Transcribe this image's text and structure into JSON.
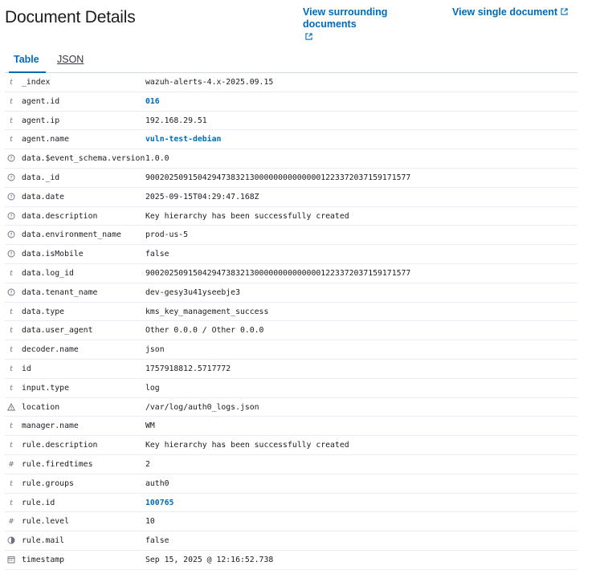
{
  "header": {
    "title": "Document Details",
    "view_surrounding": "View surrounding documents",
    "view_single": "View single document"
  },
  "tabs": [
    {
      "label": "Table",
      "active": true
    },
    {
      "label": "JSON",
      "active": false
    }
  ],
  "colors": {
    "accent": "#006bb8",
    "text": "#1a1c21",
    "muted": "#69707d",
    "divider": "#e9edf3"
  },
  "rows": [
    {
      "type": "t",
      "field": "_index",
      "value": "wazuh-alerts-4.x-2025.09.15",
      "link": false
    },
    {
      "type": "t",
      "field": "agent.id",
      "value": "016",
      "link": true
    },
    {
      "type": "t",
      "field": "agent.ip",
      "value": "192.168.29.51",
      "link": false
    },
    {
      "type": "t",
      "field": "agent.name",
      "value": "vuln-test-debian",
      "link": true
    },
    {
      "type": "?",
      "field": "data.$event_schema.version",
      "value": "1.0.0",
      "link": false
    },
    {
      "type": "?",
      "field": "data._id",
      "value": "90020250915042947383213000000000000001223372037159171577",
      "link": false
    },
    {
      "type": "?",
      "field": "data.date",
      "value": "2025-09-15T04:29:47.168Z",
      "link": false
    },
    {
      "type": "?",
      "field": "data.description",
      "value": "Key hierarchy has been successfully created",
      "link": false
    },
    {
      "type": "?",
      "field": "data.environment_name",
      "value": "prod-us-5",
      "link": false
    },
    {
      "type": "?",
      "field": "data.isMobile",
      "value": "false",
      "link": false
    },
    {
      "type": "t",
      "field": "data.log_id",
      "value": "90020250915042947383213000000000000001223372037159171577",
      "link": false
    },
    {
      "type": "?",
      "field": "data.tenant_name",
      "value": "dev-gesy3u41yseebje3",
      "link": false
    },
    {
      "type": "t",
      "field": "data.type",
      "value": "kms_key_management_success",
      "link": false
    },
    {
      "type": "t",
      "field": "data.user_agent",
      "value": "Other 0.0.0 / Other 0.0.0",
      "link": false
    },
    {
      "type": "t",
      "field": "decoder.name",
      "value": "json",
      "link": false
    },
    {
      "type": "t",
      "field": "id",
      "value": "1757918812.5717772",
      "link": false
    },
    {
      "type": "t",
      "field": "input.type",
      "value": "log",
      "link": false
    },
    {
      "type": "warn",
      "field": "location",
      "value": "/var/log/auth0_logs.json",
      "link": false
    },
    {
      "type": "t",
      "field": "manager.name",
      "value": "WM",
      "link": false
    },
    {
      "type": "t",
      "field": "rule.description",
      "value": "Key hierarchy has been successfully created",
      "link": false
    },
    {
      "type": "#",
      "field": "rule.firedtimes",
      "value": "2",
      "link": false
    },
    {
      "type": "t",
      "field": "rule.groups",
      "value": "auth0",
      "link": false
    },
    {
      "type": "t",
      "field": "rule.id",
      "value": "100765",
      "link": true
    },
    {
      "type": "#",
      "field": "rule.level",
      "value": "10",
      "link": false
    },
    {
      "type": "bool",
      "field": "rule.mail",
      "value": "false",
      "link": false
    },
    {
      "type": "date",
      "field": "timestamp",
      "value": "Sep 15, 2025 @ 12:16:52.738",
      "link": false
    }
  ]
}
